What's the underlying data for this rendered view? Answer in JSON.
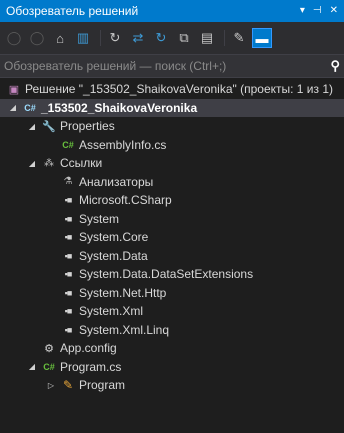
{
  "panel": {
    "title": "Обозреватель решений",
    "pin_glyph": "▾",
    "autohide_glyph": "⊣",
    "close_glyph": "✕"
  },
  "toolbar": {
    "buttons": [
      {
        "name": "back-icon",
        "glyph": "◯"
      },
      {
        "name": "forward-icon",
        "glyph": "◯"
      },
      {
        "name": "home-icon",
        "glyph": "⌂"
      },
      {
        "name": "switch-views-icon",
        "glyph": "▥"
      },
      {
        "name": "pending-changes-icon",
        "glyph": "↻"
      },
      {
        "name": "sync-icon",
        "glyph": "⇄"
      },
      {
        "name": "refresh-icon",
        "glyph": "↻"
      },
      {
        "name": "collapse-all-icon",
        "glyph": "⧉"
      },
      {
        "name": "show-all-files-icon",
        "glyph": "▤"
      },
      {
        "name": "properties-icon",
        "glyph": "✎"
      },
      {
        "name": "preview-icon",
        "glyph": "▬"
      }
    ]
  },
  "search": {
    "placeholder": "Обозреватель решений — поиск (Ctrl+;)",
    "icon_glyph": "⚲"
  },
  "tree": [
    {
      "label": "Решение \"_153502_ShaikovaVeronika\" (проекты: 1 из 1)",
      "icon": "solution-icon",
      "glyph": "▣",
      "depth": 0,
      "expander": ""
    },
    {
      "label": "_153502_ShaikovaVeronika",
      "icon": "csharp-project-icon",
      "glyph": "C#",
      "depth": 1,
      "expander": "◢",
      "selected": true
    },
    {
      "label": "Properties",
      "icon": "wrench-icon",
      "glyph": "🔧",
      "depth": 2,
      "expander": "◢"
    },
    {
      "label": "AssemblyInfo.cs",
      "icon": "csharp-file-icon",
      "glyph": "C#",
      "depth": 3,
      "expander": ""
    },
    {
      "label": "Ссылки",
      "icon": "references-icon",
      "glyph": "⁂",
      "depth": 2,
      "expander": "◢"
    },
    {
      "label": "Анализаторы",
      "icon": "analyzer-icon",
      "glyph": "⚗",
      "depth": 3,
      "expander": ""
    },
    {
      "label": "Microsoft.CSharp",
      "icon": "assembly-reference-icon",
      "glyph": "▪■",
      "depth": 3,
      "expander": ""
    },
    {
      "label": "System",
      "icon": "assembly-reference-icon",
      "glyph": "▪■",
      "depth": 3,
      "expander": ""
    },
    {
      "label": "System.Core",
      "icon": "assembly-reference-icon",
      "glyph": "▪■",
      "depth": 3,
      "expander": ""
    },
    {
      "label": "System.Data",
      "icon": "assembly-reference-icon",
      "glyph": "▪■",
      "depth": 3,
      "expander": ""
    },
    {
      "label": "System.Data.DataSetExtensions",
      "icon": "assembly-reference-icon",
      "glyph": "▪■",
      "depth": 3,
      "expander": ""
    },
    {
      "label": "System.Net.Http",
      "icon": "assembly-reference-icon",
      "glyph": "▪■",
      "depth": 3,
      "expander": ""
    },
    {
      "label": "System.Xml",
      "icon": "assembly-reference-icon",
      "glyph": "▪■",
      "depth": 3,
      "expander": ""
    },
    {
      "label": "System.Xml.Linq",
      "icon": "assembly-reference-icon",
      "glyph": "▪■",
      "depth": 3,
      "expander": ""
    },
    {
      "label": "App.config",
      "icon": "config-file-icon",
      "glyph": "⚙",
      "depth": 2,
      "expander": ""
    },
    {
      "label": "Program.cs",
      "icon": "csharp-file-icon",
      "glyph": "C#",
      "depth": 2,
      "expander": "◢"
    },
    {
      "label": "Program",
      "icon": "class-icon",
      "glyph": "✎",
      "depth": 3,
      "expander": "▷"
    }
  ]
}
